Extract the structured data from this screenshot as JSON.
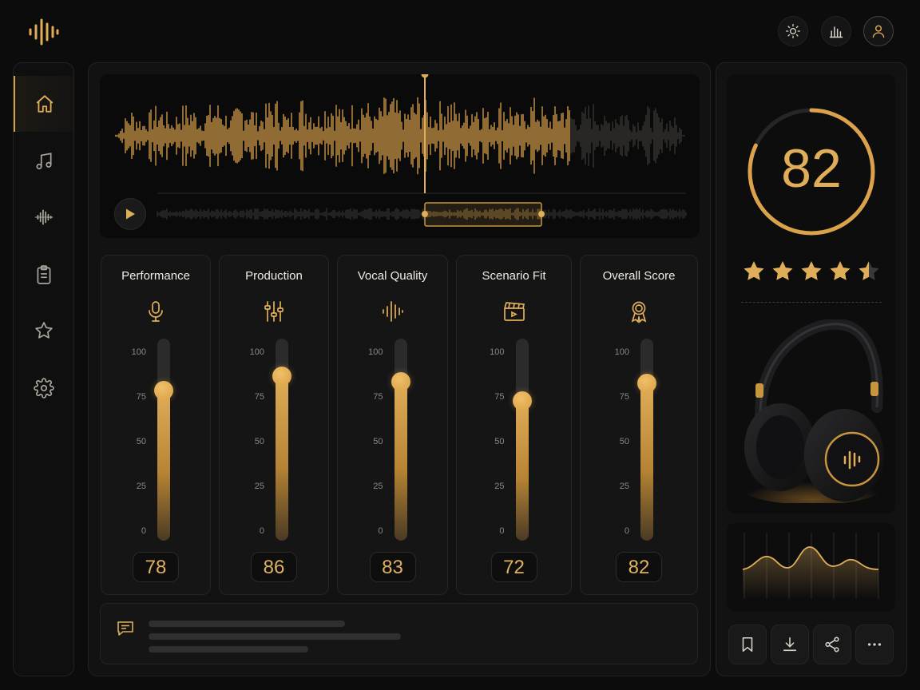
{
  "theme": {
    "accent": "#E0AE59",
    "background": "#0C0C0D",
    "panel": "#151516",
    "muted_text": "#8B877F"
  },
  "header": {
    "logo_icon": "waveform-logo-icon",
    "actions": [
      {
        "name": "brightness-button",
        "icon": "sun-icon"
      },
      {
        "name": "stats-button",
        "icon": "bar-chart-icon"
      },
      {
        "name": "profile-button",
        "icon": "user-icon"
      }
    ]
  },
  "sidebar": {
    "items": [
      {
        "icon": "home-icon",
        "active": true
      },
      {
        "icon": "music-note-icon",
        "active": false
      },
      {
        "icon": "waveform-icon",
        "active": false
      },
      {
        "icon": "clipboard-icon",
        "active": false
      },
      {
        "icon": "star-icon",
        "active": false
      },
      {
        "icon": "gear-icon",
        "active": false
      }
    ]
  },
  "player": {
    "play_icon": "play-icon",
    "progress": 0.55,
    "selection_start": 0.5,
    "selection_end": 0.72
  },
  "metrics": [
    {
      "title": "Performance",
      "icon": "microphone-icon",
      "value": "78",
      "level": 0.78
    },
    {
      "title": "Production",
      "icon": "sliders-icon",
      "value": "86",
      "level": 0.86
    },
    {
      "title": "Vocal Quality",
      "icon": "waveform-icon",
      "value": "83",
      "level": 0.83
    },
    {
      "title": "Scenario Fit",
      "icon": "clapperboard-icon",
      "value": "72",
      "level": 0.72
    },
    {
      "title": "Overall Score",
      "icon": "award-icon",
      "value": "82",
      "level": 0.82
    }
  ],
  "scale_ticks": [
    "100",
    "75",
    "50",
    "25",
    "0"
  ],
  "comment": {
    "icon": "comment-icon"
  },
  "score": {
    "value": "82",
    "ring_fraction": 0.82,
    "stars": 4.5,
    "stars_max": 5
  },
  "product_image": "headphones",
  "bottom_actions": [
    {
      "name": "bookmark-button",
      "icon": "bookmark-icon"
    },
    {
      "name": "download-button",
      "icon": "download-icon"
    },
    {
      "name": "share-button",
      "icon": "share-icon"
    },
    {
      "name": "more-button",
      "icon": "more-dots-icon"
    }
  ]
}
